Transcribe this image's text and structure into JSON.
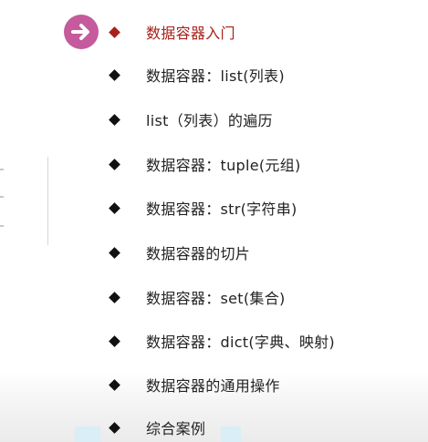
{
  "toc": {
    "items": [
      {
        "label": "数据容器入门",
        "active": true
      },
      {
        "label": "数据容器：list(列表)",
        "active": false
      },
      {
        "label": "list（列表）的遍历",
        "active": false
      },
      {
        "label": "数据容器：tuple(元组)",
        "active": false
      },
      {
        "label": "数据容器：str(字符串)",
        "active": false
      },
      {
        "label": "数据容器的切片",
        "active": false
      },
      {
        "label": "数据容器：set(集合)",
        "active": false
      },
      {
        "label": "数据容器：dict(字典、映射)",
        "active": false
      },
      {
        "label": "数据容器的通用操作",
        "active": false
      },
      {
        "label": "综合案例",
        "active": false
      }
    ]
  },
  "colors": {
    "active_text": "#a8201a",
    "marker": "#c55a9c",
    "text": "#222222"
  },
  "icons": {
    "marker": "arrow-right-circle-icon",
    "bullet": "diamond-bullet-icon"
  }
}
